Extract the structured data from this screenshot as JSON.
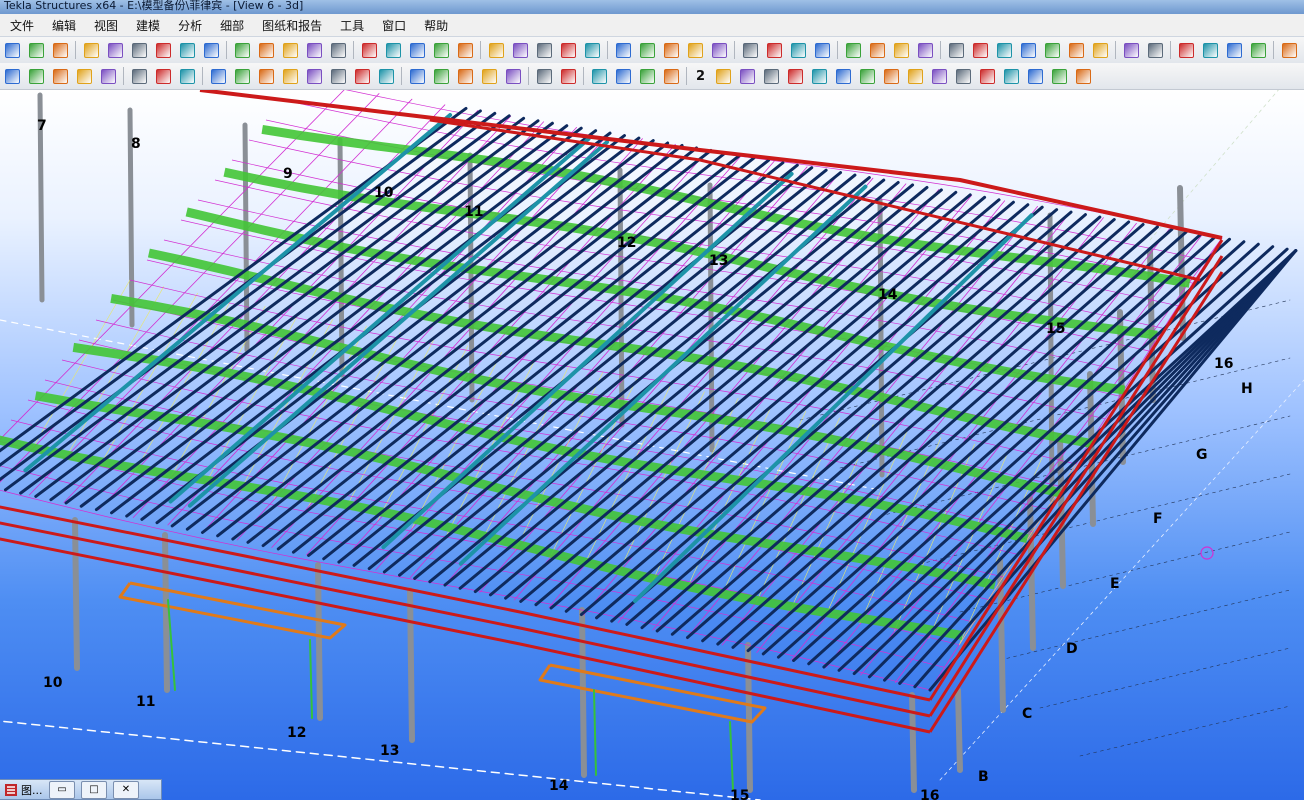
{
  "window": {
    "title": "Tekla Structures x64 - E:\\模型备份\\菲律宾 - [View 6 - 3d]"
  },
  "menu": {
    "items": [
      "文件",
      "编辑",
      "视图",
      "建模",
      "分析",
      "细部",
      "图纸和报告",
      "工具",
      "窗口",
      "帮助"
    ]
  },
  "toolbar2": {
    "number_label": "2"
  },
  "icons": {
    "toolbar1": [
      "new-file-icon",
      "open-file-icon",
      "save-icon",
      "undo-icon",
      "redo-icon",
      "copy-icon",
      "open-model-icon",
      "print-icon",
      "paste-icon",
      "window-icon",
      "window-2-icon",
      "window-3-icon",
      "cut-icon",
      "select-icon",
      "beam-icon",
      "column-icon",
      "plate-icon",
      "drawing-icon",
      "move-icon",
      "rotate-icon",
      "pick-icon",
      "snap-icon",
      "help-cursor-icon",
      "grid-line-icon",
      "grid-line-2-icon",
      "measure-icon",
      "measure-angle-icon",
      "arc-icon",
      "clip-icon",
      "wand-icon",
      "copy-object-icon",
      "move-object-icon",
      "stack-icon",
      "list-icon",
      "report-icon",
      "red-block-icon",
      "arrows-icon",
      "load-icon",
      "numbering-icon",
      "bolt-icon",
      "weld-icon",
      "part-icon",
      "assembly-icon",
      "component-icon",
      "fit-icon",
      "binoculars-icon",
      "steel-section-icon",
      "detail-icon",
      "box-icon",
      "marker-icon",
      "pencil-icon",
      "close-window-icon",
      "palette-icon"
    ],
    "toolbar2": [
      "steel-column-icon",
      "steel-beam-icon",
      "polybeam-icon",
      "curved-beam-icon",
      "plate-tool-icon",
      "bolt-tool-icon",
      "anchor-icon",
      "line-point-icon",
      "angle-point-icon",
      "midpoint-icon",
      "intersect-icon",
      "cross-point-icon",
      "perpendicular-icon",
      "snap-center-icon",
      "snap-tangent-icon",
      "help-tool-icon",
      "help-tool-2-icon",
      "numbers-icon",
      "weld-tool-icon",
      "cone-icon",
      "surface-icon",
      "grid-tool-icon",
      "align-left-icon",
      "link-icon",
      "binoculars-2-icon",
      "arrow-left-icon",
      "arrow-right-icon",
      "view-ends-icon",
      "view-top-icon",
      "view-front-icon",
      "view-back-icon",
      "view-left-icon",
      "view-right-icon",
      "view-iso-icon",
      "view-plan-icon",
      "view-section-icon",
      "view-axes-icon",
      "view-detail-icon",
      "view-column-icon",
      "view-bolt-icon",
      "view-grid-icon",
      "view-component-icon",
      "view-all-icon"
    ]
  },
  "viewport": {
    "grid_labels_axis_top": [
      "7",
      "8",
      "9",
      "10",
      "11",
      "12",
      "13",
      "14",
      "15",
      "16"
    ],
    "grid_labels_letters": [
      "H",
      "G",
      "F",
      "E",
      "D",
      "C",
      "B"
    ],
    "grid_labels_axis_bottom": [
      "10",
      "11",
      "12",
      "13",
      "14",
      "15",
      "16"
    ]
  },
  "taskbar": {
    "label": "图..."
  },
  "colors": {
    "purlin_green": "#43c536",
    "edge_red": "#cc1a1a",
    "rafter_navy": "#0e2a5e",
    "brace_magenta": "#d22fd2",
    "column_gray": "#8a8f96",
    "teal": "#1d93a8",
    "orange": "#e07a1a",
    "sky_top": "#ffffff",
    "sky_bottom": "#2c6ae8"
  }
}
